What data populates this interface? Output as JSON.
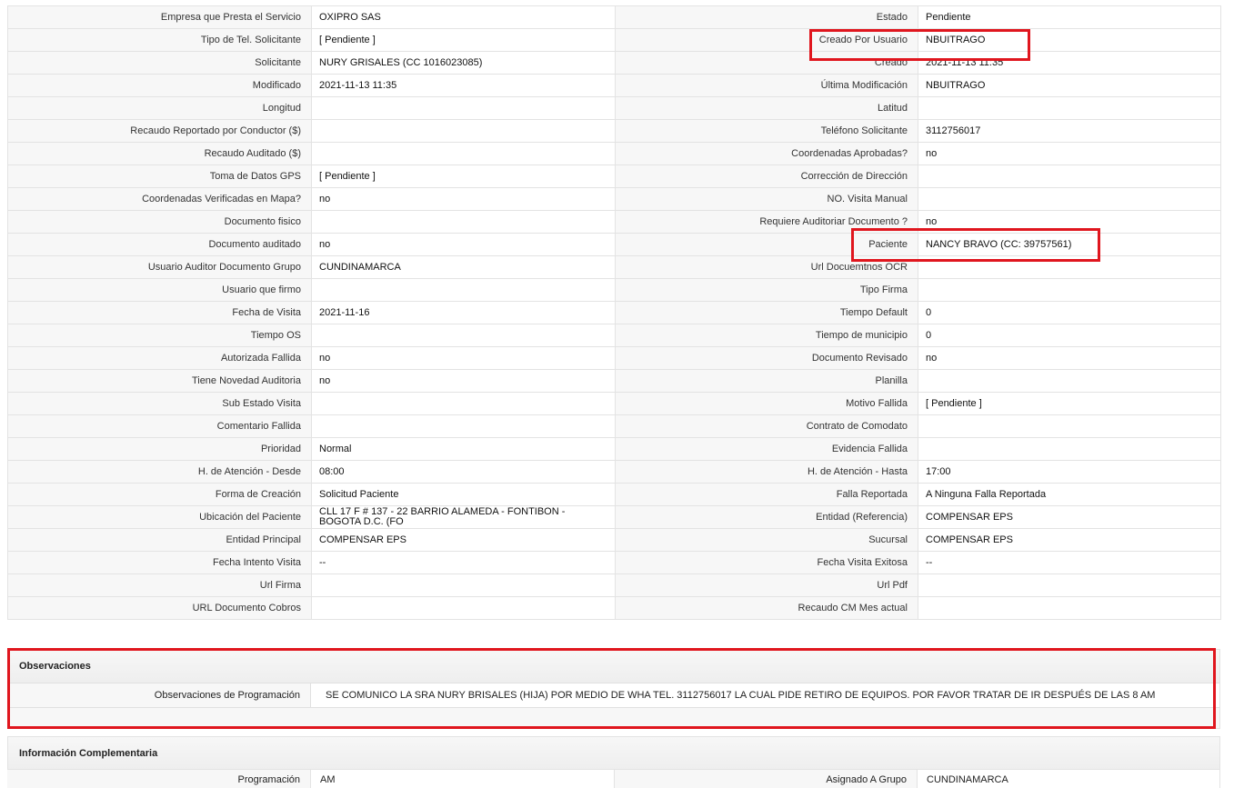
{
  "rows": [
    {
      "l1": "Empresa que Presta el Servicio",
      "v1": "OXIPRO SAS",
      "l2": "Estado",
      "v2": "Pendiente"
    },
    {
      "l1": "Tipo de Tel. Solicitante",
      "v1": "[ Pendiente ]",
      "l2": "Creado Por Usuario",
      "v2": "NBUITRAGO"
    },
    {
      "l1": "Solicitante",
      "v1": "NURY GRISALES (CC 1016023085)",
      "l2": "Creado",
      "v2": "2021-11-13 11:35"
    },
    {
      "l1": "Modificado",
      "v1": "2021-11-13 11:35",
      "l2": "Última Modificación",
      "v2": "NBUITRAGO"
    },
    {
      "l1": "Longitud",
      "v1": "",
      "l2": "Latitud",
      "v2": ""
    },
    {
      "l1": "Recaudo Reportado por Conductor ($)",
      "v1": "",
      "l2": "Teléfono Solicitante",
      "v2": "3112756017"
    },
    {
      "l1": "Recaudo Auditado ($)",
      "v1": "",
      "l2": "Coordenadas Aprobadas?",
      "v2": "no"
    },
    {
      "l1": "Toma de Datos GPS",
      "v1": "[ Pendiente ]",
      "l2": "Corrección de Dirección",
      "v2": ""
    },
    {
      "l1": "Coordenadas Verificadas en Mapa?",
      "v1": "no",
      "l2": "NO. Visita Manual",
      "v2": ""
    },
    {
      "l1": "Documento fisico",
      "v1": "",
      "l2": "Requiere Auditoriar Documento ?",
      "v2": "no"
    },
    {
      "l1": "Documento auditado",
      "v1": "no",
      "l2": "Paciente",
      "v2": "NANCY BRAVO (CC: 39757561)"
    },
    {
      "l1": "Usuario Auditor Documento Grupo",
      "v1": "CUNDINAMARCA",
      "l2": "Url Docuemtnos OCR",
      "v2": ""
    },
    {
      "l1": "Usuario que firmo",
      "v1": "",
      "l2": "Tipo Firma",
      "v2": ""
    },
    {
      "l1": "Fecha de Visita",
      "v1": "2021-11-16",
      "l2": "Tiempo Default",
      "v2": "0"
    },
    {
      "l1": "Tiempo OS",
      "v1": "",
      "l2": "Tiempo de municipio",
      "v2": "0"
    },
    {
      "l1": "Autorizada Fallida",
      "v1": "no",
      "l2": "Documento Revisado",
      "v2": "no"
    },
    {
      "l1": "Tiene Novedad Auditoria",
      "v1": "no",
      "l2": "Planilla",
      "v2": ""
    },
    {
      "l1": "Sub Estado Visita",
      "v1": "",
      "l2": "Motivo Fallida",
      "v2": "[ Pendiente ]"
    },
    {
      "l1": "Comentario Fallida",
      "v1": "",
      "l2": "Contrato de Comodato",
      "v2": ""
    },
    {
      "l1": "Prioridad",
      "v1": "Normal",
      "l2": "Evidencia Fallida",
      "v2": ""
    },
    {
      "l1": "H. de Atención - Desde",
      "v1": "08:00",
      "l2": "H. de Atención - Hasta",
      "v2": "17:00"
    },
    {
      "l1": "Forma de Creación",
      "v1": "Solicitud Paciente",
      "l2": "Falla Reportada",
      "v2": "A Ninguna Falla Reportada"
    },
    {
      "l1": "Ubicación del Paciente",
      "v1": "CLL 17 F # 137 - 22 BARRIO ALAMEDA - FONTIBON - BOGOTA D.C. (FO",
      "l2": "Entidad (Referencia)",
      "v2": "COMPENSAR EPS"
    },
    {
      "l1": "Entidad Principal",
      "v1": "COMPENSAR EPS",
      "l2": "Sucursal",
      "v2": "COMPENSAR EPS"
    },
    {
      "l1": "Fecha Intento Visita",
      "v1": "--",
      "l2": "Fecha Visita Exitosa",
      "v2": "--"
    },
    {
      "l1": "Url Firma",
      "v1": "",
      "l2": "Url Pdf",
      "v2": ""
    },
    {
      "l1": "URL Documento Cobros",
      "v1": "",
      "l2": "Recaudo CM Mes actual",
      "v2": ""
    }
  ],
  "observaciones": {
    "title": "Observaciones",
    "label": "Observaciones de Programación",
    "value": "SE COMUNICO LA SRA NURY BRISALES (HIJA) POR MEDIO DE WHA TEL. 3112756017 LA CUAL PIDE RETIRO DE EQUIPOS. POR FAVOR TRATAR DE IR DESPUÉS DE LAS 8 AM"
  },
  "complementaria": {
    "title": "Información Complementaria",
    "l1": "Programación",
    "v1": "AM",
    "l2": "Asignado A Grupo",
    "v2": "CUNDINAMARCA"
  },
  "highlight_color": "#e0161e"
}
